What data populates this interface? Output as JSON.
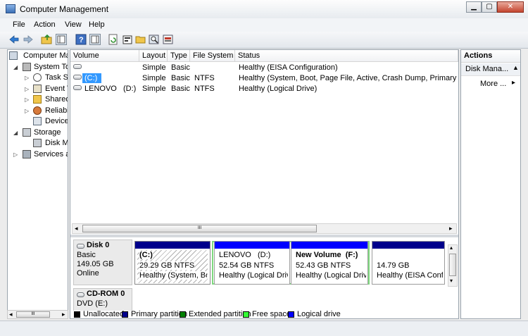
{
  "window": {
    "title": "Computer Management",
    "minimize": "▁",
    "maximize": "▢",
    "close": "✕"
  },
  "menu": [
    "File",
    "Action",
    "View",
    "Help"
  ],
  "tree": {
    "root": "Computer Ma",
    "system_tools": "System To",
    "task_scheduler": "Task S",
    "event_viewer": "Event V",
    "shared_folders": "Shared",
    "reliability": "Reliabi",
    "device_manager": "Device",
    "storage": "Storage",
    "disk_management": "Disk M",
    "services": "Services ar"
  },
  "columns": [
    "Volume",
    "Layout",
    "Type",
    "File System",
    "Status"
  ],
  "volumes": [
    {
      "volume": "",
      "layout": "Simple",
      "type": "Basic",
      "fs": "",
      "status": "Healthy (EISA Configuration)"
    },
    {
      "volume": "(C:)",
      "layout": "Simple",
      "type": "Basic",
      "fs": "NTFS",
      "status": "Healthy (System, Boot, Page File, Active, Crash Dump, Primary Partitio"
    },
    {
      "volume": "LENOVO   (D:)",
      "layout": "Simple",
      "type": "Basic",
      "fs": "NTFS",
      "status": "Healthy (Logical Drive)"
    }
  ],
  "scroll_grip": "III",
  "disk0": {
    "name": "Disk 0",
    "type": "Basic",
    "size": "149.05 GB",
    "state": "Online",
    "partitions": [
      {
        "name": "(C:)",
        "size": "29.29 GB NTFS",
        "status": "Healthy (System, Boo",
        "bar_color": "#00008b"
      },
      {
        "name": "LENOVO   (D:)",
        "size": "52.54 GB NTFS",
        "status": "Healthy (Logical Drive",
        "bar_color": "#0000ff"
      },
      {
        "name": "New Volume  (F:)",
        "size": "52.43 GB NTFS",
        "status": "Healthy (Logical Drive",
        "bar_color": "#0000ff"
      },
      {
        "name": "",
        "size": "14.79 GB",
        "status": "Healthy (EISA Config",
        "bar_color": "#00008b"
      }
    ]
  },
  "cdrom": {
    "name": "CD-ROM 0",
    "drive": "DVD (E:)"
  },
  "legend": [
    {
      "label": "Unallocated",
      "color": "#000000"
    },
    {
      "label": "Primary partition",
      "color": "#00008b"
    },
    {
      "label": "Extended partition",
      "color": "#008000"
    },
    {
      "label": "Free space",
      "color": "#33ff33"
    },
    {
      "label": "Logical drive",
      "color": "#0000ff"
    }
  ],
  "actions": {
    "header": "Actions",
    "section": "Disk Mana...",
    "more": "More ...",
    "collapse_arrow": "▲",
    "more_arrow": "▸"
  },
  "tree_scroll": {
    "left": "◂",
    "right": "▸",
    "grip": "III"
  }
}
